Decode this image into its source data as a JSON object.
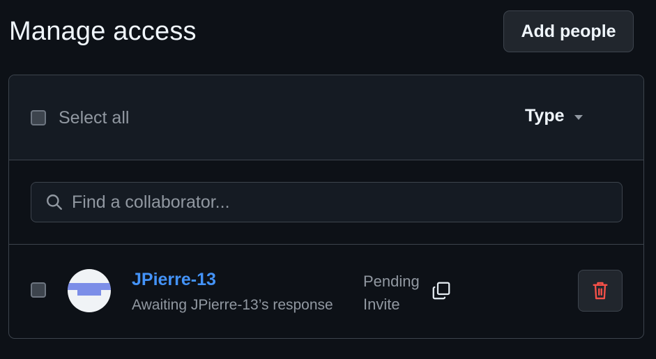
{
  "header": {
    "title": "Manage access",
    "add_button_label": "Add people"
  },
  "list": {
    "select_all_label": "Select all",
    "select_all_checked": false,
    "type_filter_label": "Type"
  },
  "search": {
    "placeholder": "Find a collaborator...",
    "value": ""
  },
  "collaborators": [
    {
      "username": "JPierre-13",
      "status": "Awaiting JPierre-13’s response",
      "badge_line1": "Pending",
      "badge_line2": "Invite",
      "checked": false
    }
  ],
  "icons": {
    "search": "search-icon",
    "caret": "triangle-down-icon",
    "copy": "copy-icon",
    "delete": "trash-icon"
  },
  "colors": {
    "background": "#0d1117",
    "link": "#4493f8",
    "danger": "#f85149",
    "border": "#3d444d"
  }
}
